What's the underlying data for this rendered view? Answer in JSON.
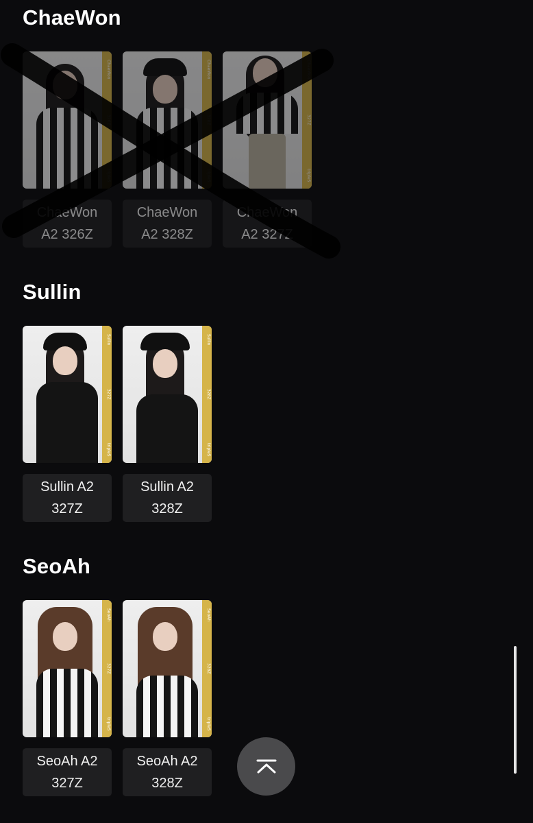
{
  "sections": [
    {
      "title": "ChaeWon",
      "cards": [
        {
          "name": "ChaeWon",
          "code": "A2 326Z",
          "band": [
            "ChaeWon",
            "326Z",
            "tripleS"
          ],
          "crossed": true
        },
        {
          "name": "ChaeWon",
          "code": "A2 328Z",
          "band": [
            "ChaeWon",
            "328Z",
            "tripleS"
          ],
          "crossed": true
        },
        {
          "name": "ChaeWon",
          "code": "A2 327Z",
          "band": [
            "ChaeWon",
            "327Z",
            "tripleS"
          ],
          "crossed": true
        }
      ]
    },
    {
      "title": "Sullin",
      "cards": [
        {
          "name": "Sullin A2",
          "code": "327Z",
          "band": [
            "Sullin",
            "327Z",
            "tripleS"
          ],
          "crossed": false
        },
        {
          "name": "Sullin A2",
          "code": "328Z",
          "band": [
            "Sullin",
            "328Z",
            "tripleS"
          ],
          "crossed": false
        }
      ]
    },
    {
      "title": "SeoAh",
      "cards": [
        {
          "name": "SeoAh A2",
          "code": "327Z",
          "band": [
            "SeoAh",
            "327Z",
            "tripleS"
          ],
          "crossed": false
        },
        {
          "name": "SeoAh A2",
          "code": "328Z",
          "band": [
            "SeoAh",
            "328Z",
            "tripleS"
          ],
          "crossed": false
        }
      ]
    }
  ],
  "scroll_top_icon": "chevron-up-bar-icon",
  "colors": {
    "background": "#0b0b0d",
    "label_bg": "#1f1f21",
    "band": "#d5b44a"
  }
}
